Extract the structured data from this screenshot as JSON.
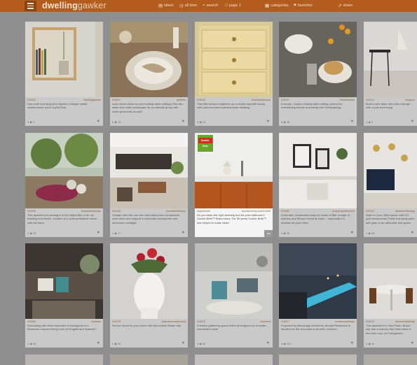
{
  "header": {
    "logo_bold": "dwelling",
    "logo_light": "gawker",
    "nav": [
      {
        "icon": "▤",
        "label": "latest"
      },
      {
        "icon": "◷",
        "label": "all time"
      },
      {
        "icon": "⌕",
        "label": "search"
      },
      {
        "icon": "□",
        "label": "page 1"
      },
      {
        "icon": "▦",
        "label": "categories"
      },
      {
        "icon": "♥",
        "label": "favorites"
      },
      {
        "icon": "↗",
        "label": "share"
      }
    ]
  },
  "cards": [
    {
      "id": "#19101",
      "source": "dwellinggawker",
      "desc": "Use crate and tang kit to fashion a simple hybrid shelf/sconce! (via A Joyful Riot)",
      "stats": "4 ◉ 9"
    },
    {
      "id": "#19097",
      "source": "griffante",
      "desc": "Last minute ideas for your holiday table settings! See this clean and rustic tablescape for an intimate group with some great eats as well!",
      "stats": "6 ◉ 13"
    },
    {
      "id": "#19103",
      "source": "vibeiswhatsname",
      "desc": "This little dresser brightens up a cloudy day with sunny milk paint and hand painted white detailing.",
      "stats": "4 ◉ 23"
    },
    {
      "id": "#19107",
      "source": "thefreekickss",
      "desc": "A simple, modern holiday table setting, perfect for entertaining friends and family this Thanksgiving.",
      "stats": "8 ◉ 33"
    },
    {
      "id": "#19114",
      "source": "theatrics",
      "desc": "Build a side table with extra storage with a (via ohoh blog)",
      "stats": "4 ◉ 3"
    },
    {
      "id": "#19102",
      "source": "homeworlddesign",
      "desc": "This apartment is arranged in the bright attic of an old building from Berlin, located on a quiet pedestrian street with old trees.",
      "stats": "2 ◉ 20"
    },
    {
      "id": "#19104",
      "source": "homeworlddesign",
      "desc": "Vintage and retro are the main styles that complement each other and support a bohemian atmosphere and somehow nostalgia.",
      "stats": "1 ◉ 17"
    },
    {
      "id": "#sponsored",
      "source": "sponsored by scotch-brite",
      "desc": "Do you have the right cleaning tool for your bathroom? Scotch-Brite™ Brand does. For 50 years Scotch-Brite™ has helped to make clean.",
      "stats": "",
      "highlight": true,
      "brand": "Scotch-Brite",
      "badge": "ad"
    },
    {
      "id": "#19082",
      "source": "sumperrypreference",
      "desc": "A few fast, inexpensive ways to create a little change of scenery and lift your mood at home – especially if it doubles as your office.",
      "stats": "4 ◉ 30"
    },
    {
      "id": "#19122",
      "source": "apartmenttherapy",
      "desc": "Style on your office space with DIY gold accessories! Paint and spray paint add glam to an otherwise dull space.",
      "stats": "1 ◉ 26"
    },
    {
      "id": "#19080",
      "source": "casakiss",
      "desc": "Decorating with fresh branches of eucalyptus in a Moroccan inspired living room (in English and Spanish).",
      "stats": "4 ◉ 49"
    },
    {
      "id": "#19079",
      "source": "delicatewoodwending",
      "desc": "Set the mood for your home with this festive Winter tale.",
      "stats": "2 ◉ 39"
    },
    {
      "id": "#19078",
      "source": "homeedit",
      "desc": "A festive gathering space that's all wrapped-up in winter-wonderland style",
      "stats": "3 ◉ 59"
    },
    {
      "id": "#19077",
      "source": "homeworlddesign",
      "desc": "Projected by Blomipage Architects, Amchit Residence is situated on the sea coast in Amchit, Lebanon.",
      "stats": "3 ◉ 109"
    },
    {
      "id": "#19076",
      "source": "homeworlddesign",
      "desc": "This apartment in Sao Paulo, Brazil city, has a country vibe that makes it feel and cozy. (in Portuguese)",
      "stats": "4 ◉ 42"
    }
  ]
}
